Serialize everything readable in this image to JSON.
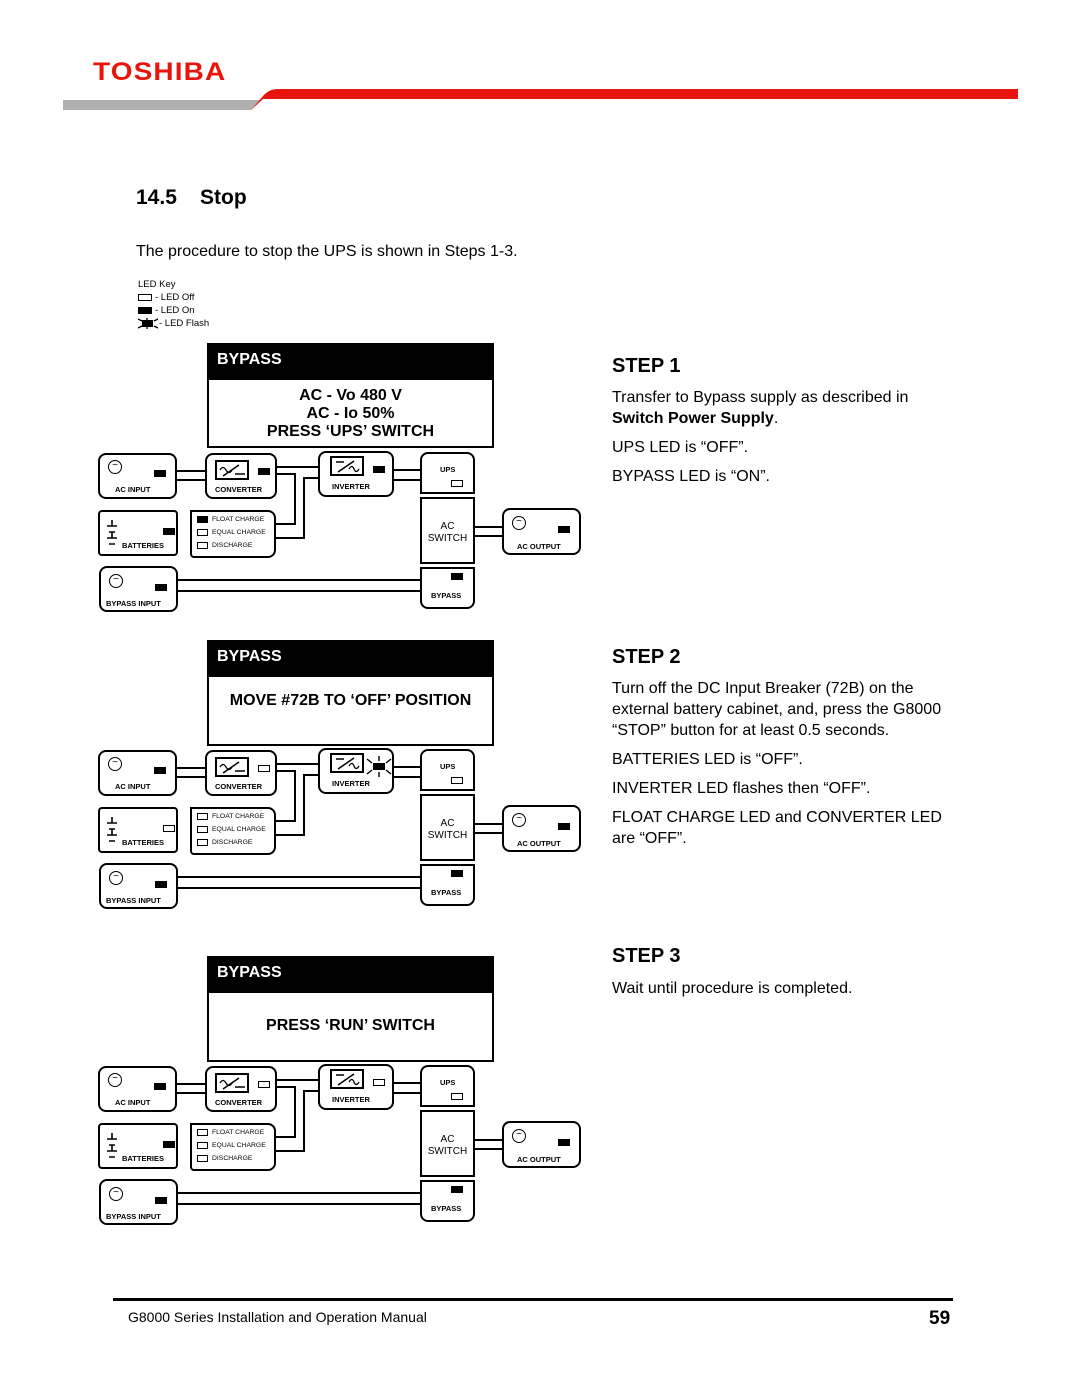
{
  "header": {
    "brand": "TOSHIBA",
    "colors": {
      "brand_red": "#e8150f",
      "band_gray": "#b0b0b0"
    }
  },
  "section": {
    "number": "14.5",
    "title": "Stop"
  },
  "intro": "The procedure to stop the UPS is shown in Steps 1-3.",
  "led_key": {
    "title": "LED Key",
    "items": [
      {
        "state": "off",
        "label": "- LED Off"
      },
      {
        "state": "on",
        "label": "- LED On"
      },
      {
        "state": "flash",
        "label": "- LED Flash"
      }
    ]
  },
  "labels": {
    "ac_input": "AC INPUT",
    "converter": "CONVERTER",
    "inverter": "INVERTER",
    "ups": "UPS",
    "batteries": "BATTERIES",
    "float_charge": "FLOAT CHARGE",
    "equal_charge": "EQUAL CHARGE",
    "discharge": "DISCHARGE",
    "ac_switch_1": "AC",
    "ac_switch_2": "SWITCH",
    "ac_output": "AC OUTPUT",
    "bypass_input": "BYPASS INPUT",
    "bypass": "BYPASS"
  },
  "steps": [
    {
      "title": "STEP 1",
      "lcd": {
        "mode": "BYPASS",
        "lines": [
          "AC - Vo  480 V",
          "AC - Io  50%",
          "PRESS ‘UPS’ SWITCH"
        ]
      },
      "text": [
        {
          "before": "Transfer to Bypass supply as described in ",
          "bold": "Switch Power Supply",
          "after": "."
        },
        {
          "before": "UPS LED is “OFF”."
        },
        {
          "before": "BYPASS LED is  “ON”."
        }
      ],
      "leds": {
        "ac_input": "on",
        "converter": "on",
        "inverter": "on",
        "ups": "off",
        "batteries": "on",
        "float_charge": "on",
        "equal_charge": "off",
        "discharge": "off",
        "ac_output": "on",
        "bypass_input": "on",
        "bypass": "on"
      }
    },
    {
      "title": "STEP 2",
      "lcd": {
        "mode": "BYPASS",
        "lines": [
          "MOVE #72B TO ‘OFF’ POSITION"
        ]
      },
      "text": [
        {
          "before": "Turn off the DC Input Breaker (72B) on the external battery cabinet, and, press the G8000 “STOP”  button for at least 0.5 seconds."
        },
        {
          "before": "BATTERIES LED is “OFF”."
        },
        {
          "before": "INVERTER LED flashes then “OFF”."
        },
        {
          "before": "FLOAT CHARGE LED and CONVERTER LED are “OFF”."
        }
      ],
      "leds": {
        "ac_input": "on",
        "converter": "off",
        "inverter": "flash",
        "ups": "off",
        "batteries": "off",
        "float_charge": "off",
        "equal_charge": "off",
        "discharge": "off",
        "ac_output": "on",
        "bypass_input": "on",
        "bypass": "on"
      }
    },
    {
      "title": "STEP 3",
      "lcd": {
        "mode": "BYPASS",
        "lines": [
          "PRESS ‘RUN’ SWITCH"
        ]
      },
      "text": [
        {
          "before": "Wait until procedure is completed."
        }
      ],
      "leds": {
        "ac_input": "on",
        "converter": "off",
        "inverter": "off",
        "ups": "off",
        "batteries": "on",
        "float_charge": "off",
        "equal_charge": "off",
        "discharge": "off",
        "ac_output": "on",
        "bypass_input": "on",
        "bypass": "on"
      }
    }
  ],
  "footer": {
    "manual": "G8000 Series Installation and Operation Manual",
    "page": "59"
  }
}
